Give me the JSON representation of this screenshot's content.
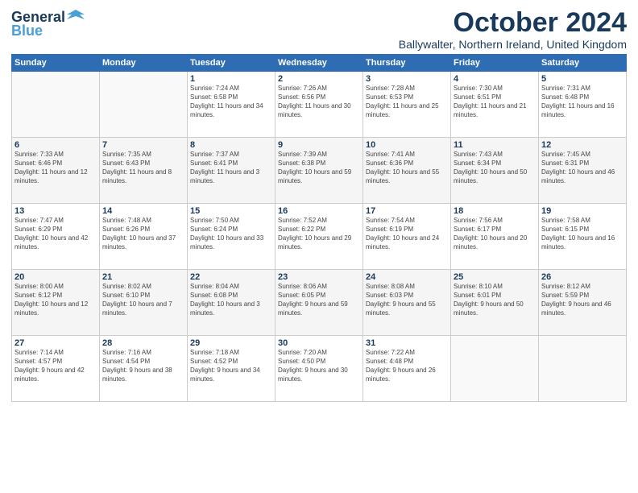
{
  "logo": {
    "line1": "General",
    "line2": "Blue"
  },
  "title": "October 2024",
  "subtitle": "Ballywalter, Northern Ireland, United Kingdom",
  "days_header": [
    "Sunday",
    "Monday",
    "Tuesday",
    "Wednesday",
    "Thursday",
    "Friday",
    "Saturday"
  ],
  "weeks": [
    [
      {
        "day": "",
        "sunrise": "",
        "sunset": "",
        "daylight": ""
      },
      {
        "day": "",
        "sunrise": "",
        "sunset": "",
        "daylight": ""
      },
      {
        "day": "1",
        "sunrise": "Sunrise: 7:24 AM",
        "sunset": "Sunset: 6:58 PM",
        "daylight": "Daylight: 11 hours and 34 minutes."
      },
      {
        "day": "2",
        "sunrise": "Sunrise: 7:26 AM",
        "sunset": "Sunset: 6:56 PM",
        "daylight": "Daylight: 11 hours and 30 minutes."
      },
      {
        "day": "3",
        "sunrise": "Sunrise: 7:28 AM",
        "sunset": "Sunset: 6:53 PM",
        "daylight": "Daylight: 11 hours and 25 minutes."
      },
      {
        "day": "4",
        "sunrise": "Sunrise: 7:30 AM",
        "sunset": "Sunset: 6:51 PM",
        "daylight": "Daylight: 11 hours and 21 minutes."
      },
      {
        "day": "5",
        "sunrise": "Sunrise: 7:31 AM",
        "sunset": "Sunset: 6:48 PM",
        "daylight": "Daylight: 11 hours and 16 minutes."
      }
    ],
    [
      {
        "day": "6",
        "sunrise": "Sunrise: 7:33 AM",
        "sunset": "Sunset: 6:46 PM",
        "daylight": "Daylight: 11 hours and 12 minutes."
      },
      {
        "day": "7",
        "sunrise": "Sunrise: 7:35 AM",
        "sunset": "Sunset: 6:43 PM",
        "daylight": "Daylight: 11 hours and 8 minutes."
      },
      {
        "day": "8",
        "sunrise": "Sunrise: 7:37 AM",
        "sunset": "Sunset: 6:41 PM",
        "daylight": "Daylight: 11 hours and 3 minutes."
      },
      {
        "day": "9",
        "sunrise": "Sunrise: 7:39 AM",
        "sunset": "Sunset: 6:38 PM",
        "daylight": "Daylight: 10 hours and 59 minutes."
      },
      {
        "day": "10",
        "sunrise": "Sunrise: 7:41 AM",
        "sunset": "Sunset: 6:36 PM",
        "daylight": "Daylight: 10 hours and 55 minutes."
      },
      {
        "day": "11",
        "sunrise": "Sunrise: 7:43 AM",
        "sunset": "Sunset: 6:34 PM",
        "daylight": "Daylight: 10 hours and 50 minutes."
      },
      {
        "day": "12",
        "sunrise": "Sunrise: 7:45 AM",
        "sunset": "Sunset: 6:31 PM",
        "daylight": "Daylight: 10 hours and 46 minutes."
      }
    ],
    [
      {
        "day": "13",
        "sunrise": "Sunrise: 7:47 AM",
        "sunset": "Sunset: 6:29 PM",
        "daylight": "Daylight: 10 hours and 42 minutes."
      },
      {
        "day": "14",
        "sunrise": "Sunrise: 7:48 AM",
        "sunset": "Sunset: 6:26 PM",
        "daylight": "Daylight: 10 hours and 37 minutes."
      },
      {
        "day": "15",
        "sunrise": "Sunrise: 7:50 AM",
        "sunset": "Sunset: 6:24 PM",
        "daylight": "Daylight: 10 hours and 33 minutes."
      },
      {
        "day": "16",
        "sunrise": "Sunrise: 7:52 AM",
        "sunset": "Sunset: 6:22 PM",
        "daylight": "Daylight: 10 hours and 29 minutes."
      },
      {
        "day": "17",
        "sunrise": "Sunrise: 7:54 AM",
        "sunset": "Sunset: 6:19 PM",
        "daylight": "Daylight: 10 hours and 24 minutes."
      },
      {
        "day": "18",
        "sunrise": "Sunrise: 7:56 AM",
        "sunset": "Sunset: 6:17 PM",
        "daylight": "Daylight: 10 hours and 20 minutes."
      },
      {
        "day": "19",
        "sunrise": "Sunrise: 7:58 AM",
        "sunset": "Sunset: 6:15 PM",
        "daylight": "Daylight: 10 hours and 16 minutes."
      }
    ],
    [
      {
        "day": "20",
        "sunrise": "Sunrise: 8:00 AM",
        "sunset": "Sunset: 6:12 PM",
        "daylight": "Daylight: 10 hours and 12 minutes."
      },
      {
        "day": "21",
        "sunrise": "Sunrise: 8:02 AM",
        "sunset": "Sunset: 6:10 PM",
        "daylight": "Daylight: 10 hours and 7 minutes."
      },
      {
        "day": "22",
        "sunrise": "Sunrise: 8:04 AM",
        "sunset": "Sunset: 6:08 PM",
        "daylight": "Daylight: 10 hours and 3 minutes."
      },
      {
        "day": "23",
        "sunrise": "Sunrise: 8:06 AM",
        "sunset": "Sunset: 6:05 PM",
        "daylight": "Daylight: 9 hours and 59 minutes."
      },
      {
        "day": "24",
        "sunrise": "Sunrise: 8:08 AM",
        "sunset": "Sunset: 6:03 PM",
        "daylight": "Daylight: 9 hours and 55 minutes."
      },
      {
        "day": "25",
        "sunrise": "Sunrise: 8:10 AM",
        "sunset": "Sunset: 6:01 PM",
        "daylight": "Daylight: 9 hours and 50 minutes."
      },
      {
        "day": "26",
        "sunrise": "Sunrise: 8:12 AM",
        "sunset": "Sunset: 5:59 PM",
        "daylight": "Daylight: 9 hours and 46 minutes."
      }
    ],
    [
      {
        "day": "27",
        "sunrise": "Sunrise: 7:14 AM",
        "sunset": "Sunset: 4:57 PM",
        "daylight": "Daylight: 9 hours and 42 minutes."
      },
      {
        "day": "28",
        "sunrise": "Sunrise: 7:16 AM",
        "sunset": "Sunset: 4:54 PM",
        "daylight": "Daylight: 9 hours and 38 minutes."
      },
      {
        "day": "29",
        "sunrise": "Sunrise: 7:18 AM",
        "sunset": "Sunset: 4:52 PM",
        "daylight": "Daylight: 9 hours and 34 minutes."
      },
      {
        "day": "30",
        "sunrise": "Sunrise: 7:20 AM",
        "sunset": "Sunset: 4:50 PM",
        "daylight": "Daylight: 9 hours and 30 minutes."
      },
      {
        "day": "31",
        "sunrise": "Sunrise: 7:22 AM",
        "sunset": "Sunset: 4:48 PM",
        "daylight": "Daylight: 9 hours and 26 minutes."
      },
      {
        "day": "",
        "sunrise": "",
        "sunset": "",
        "daylight": ""
      },
      {
        "day": "",
        "sunrise": "",
        "sunset": "",
        "daylight": ""
      }
    ]
  ]
}
